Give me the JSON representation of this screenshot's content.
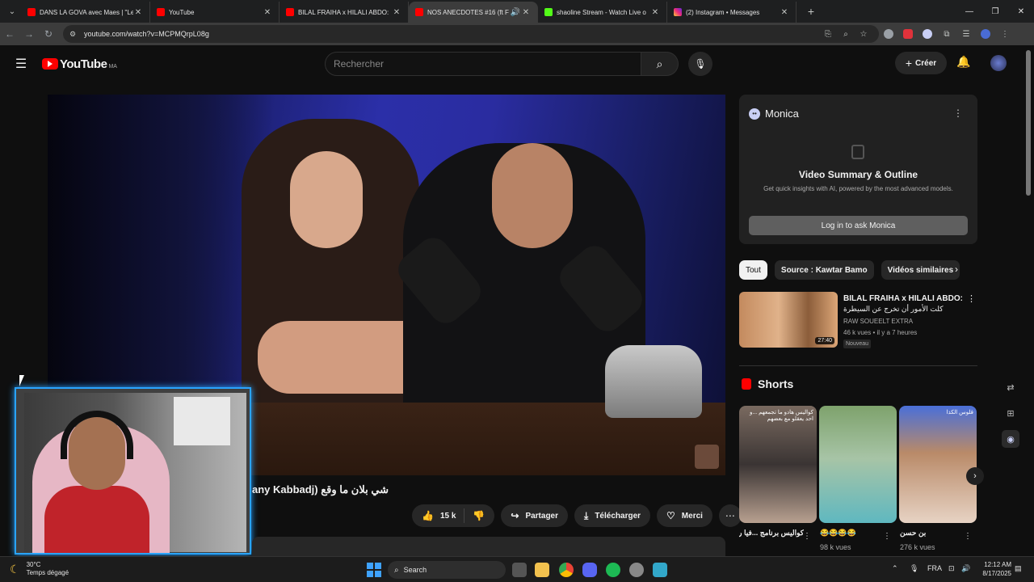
{
  "browser": {
    "tabs": [
      {
        "title": "DANS LA GOVA avec Maes | \"Le",
        "favicon": "youtube-icon",
        "active": false
      },
      {
        "title": "YouTube",
        "favicon": "youtube-icon",
        "active": false
      },
      {
        "title": "BILAL FRAIHA x HILALI ABDO:",
        "favicon": "youtube-icon",
        "active": false
      },
      {
        "title": "NOS ANECDOTES #16 (ft F",
        "favicon": "youtube-icon",
        "active": true
      },
      {
        "title": "shaoline Stream - Watch Live o",
        "favicon": "kick-icon",
        "active": false
      },
      {
        "title": "(2) Instagram • Messages",
        "favicon": "instagram-icon",
        "active": false
      }
    ],
    "url": "youtube.com/watch?v=MCPMQrpL08g",
    "accent_color": "#ff0000"
  },
  "youtube": {
    "logo_text": "YouTube",
    "country_code": "MA",
    "search_placeholder": "Rechercher",
    "create_label": "Créer"
  },
  "video": {
    "title_visible": "شي بلان ما وقع (any Kabbadj",
    "likes": "15 k",
    "share_label": "Partager",
    "download_label": "Télécharger",
    "thanks_label": "Merci"
  },
  "monica": {
    "name": "Monica",
    "heading": "Video Summary & Outline",
    "subtext": "Get quick insights with AI, powered by the most advanced models.",
    "login_label": "Log in to ask Monica"
  },
  "chips": [
    "Tout",
    "Source : Kawtar Bamo",
    "Vidéos similaires"
  ],
  "recommended": {
    "title": "BILAL FRAIHA x HILALI ABDO:",
    "subtitle_ar": "كلت الأمور أن تخرج عن السيطرة",
    "channel": "RAW SOUEELT EXTRA",
    "meta": "46 k vues • il y a 7 heures",
    "badge": "Nouveau",
    "duration": "27:40"
  },
  "shorts": {
    "heading": "Shorts",
    "items": [
      {
        "title": "كواليس برنامج ...فيا رجاء بلمير و",
        "views": "",
        "caption": "كواليس هادو ما تجمعهم ...و احد يعقلو مع بعضهم"
      },
      {
        "title": "😂😂😂😂",
        "views": "98 k vues",
        "caption": ""
      },
      {
        "title": "بن حسن",
        "views": "276 k vues",
        "caption": "قلوس الكذا"
      }
    ]
  },
  "taskbar": {
    "temperature": "30°C",
    "weather_text": "Temps dégagé",
    "search_label": "Search",
    "language": "FRA",
    "time": "12:12 AM",
    "date": "8/17/2025"
  }
}
